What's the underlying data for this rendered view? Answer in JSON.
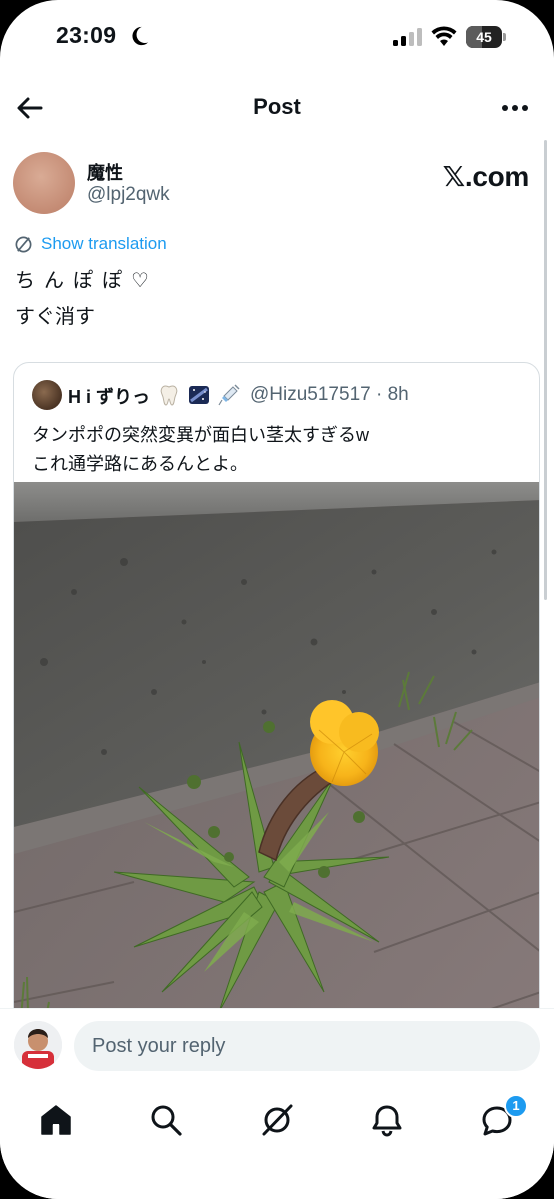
{
  "status_bar": {
    "time": "23:09",
    "battery_level": "45"
  },
  "header": {
    "title": "Post"
  },
  "post": {
    "display_name": "魔性",
    "handle": "@lpj2qwk",
    "watermark": "𝕏.com",
    "translate_label": "Show translation",
    "text_line1": "ちんぽぽ♡",
    "text_line2": "すぐ消す"
  },
  "quote": {
    "name": "H i ずりっ",
    "handle_time": "@Hizu517517 · 8h",
    "text_line1": "タンポポの突然変異が面白い茎太すぎるw",
    "text_line2": "これ通学路にあるんとよ。"
  },
  "reply": {
    "placeholder": "Post your reply"
  },
  "tabs": {
    "notifications_badge": "1"
  },
  "colors": {
    "accent": "#1d9bf0",
    "text": "#0f1419",
    "secondary": "#536471"
  }
}
